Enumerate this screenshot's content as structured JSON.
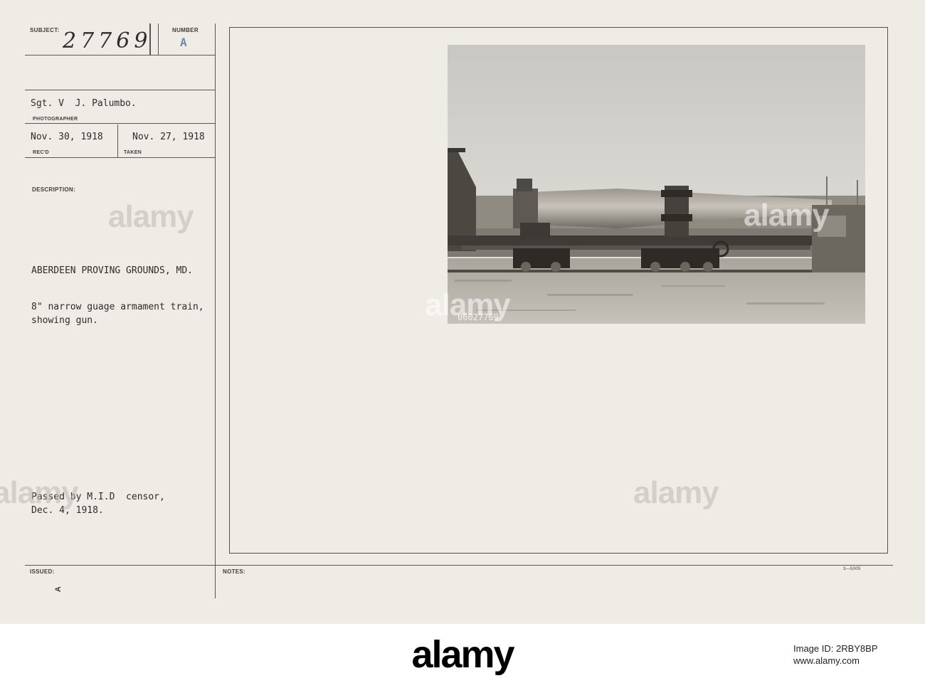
{
  "card": {
    "subject_label": "SUBJECT:",
    "number_label": "NUMBER",
    "subject_number": "27769",
    "number_value": "A",
    "photographer": "Sgt. V  J. Palumbo.",
    "photographer_label": "PHOTOGRAPHER",
    "received_date": "Nov. 30, 1918",
    "received_label": "REC'D",
    "taken_date": "Nov. 27, 1918",
    "taken_label": "TAKEN",
    "description_label": "DESCRIPTION:",
    "location": "ABERDEEN PROVING GROUNDS, MD.",
    "description_line1": "8\" narrow guage armament train,",
    "description_line2": "showing gun.",
    "censor_line1": "Passed by M.I.D  censor,",
    "censor_line2": "Dec. 4, 1918.",
    "issued_label": "ISSUED:",
    "notes_label": "NOTES:",
    "form_code": "3—5005",
    "bottom_mark": "A"
  },
  "photo": {
    "negative_number": "06027769"
  },
  "watermark": {
    "text": "alamy"
  },
  "footer": {
    "logo": "alamy",
    "image_id_label": "Image ID: 2RBY8BP",
    "site": "www.alamy.com"
  },
  "colors": {
    "card_background": "#efece5",
    "rule_lines": "#5a5752",
    "ink": "#2e2c29",
    "footer_background": "#ffffff"
  }
}
